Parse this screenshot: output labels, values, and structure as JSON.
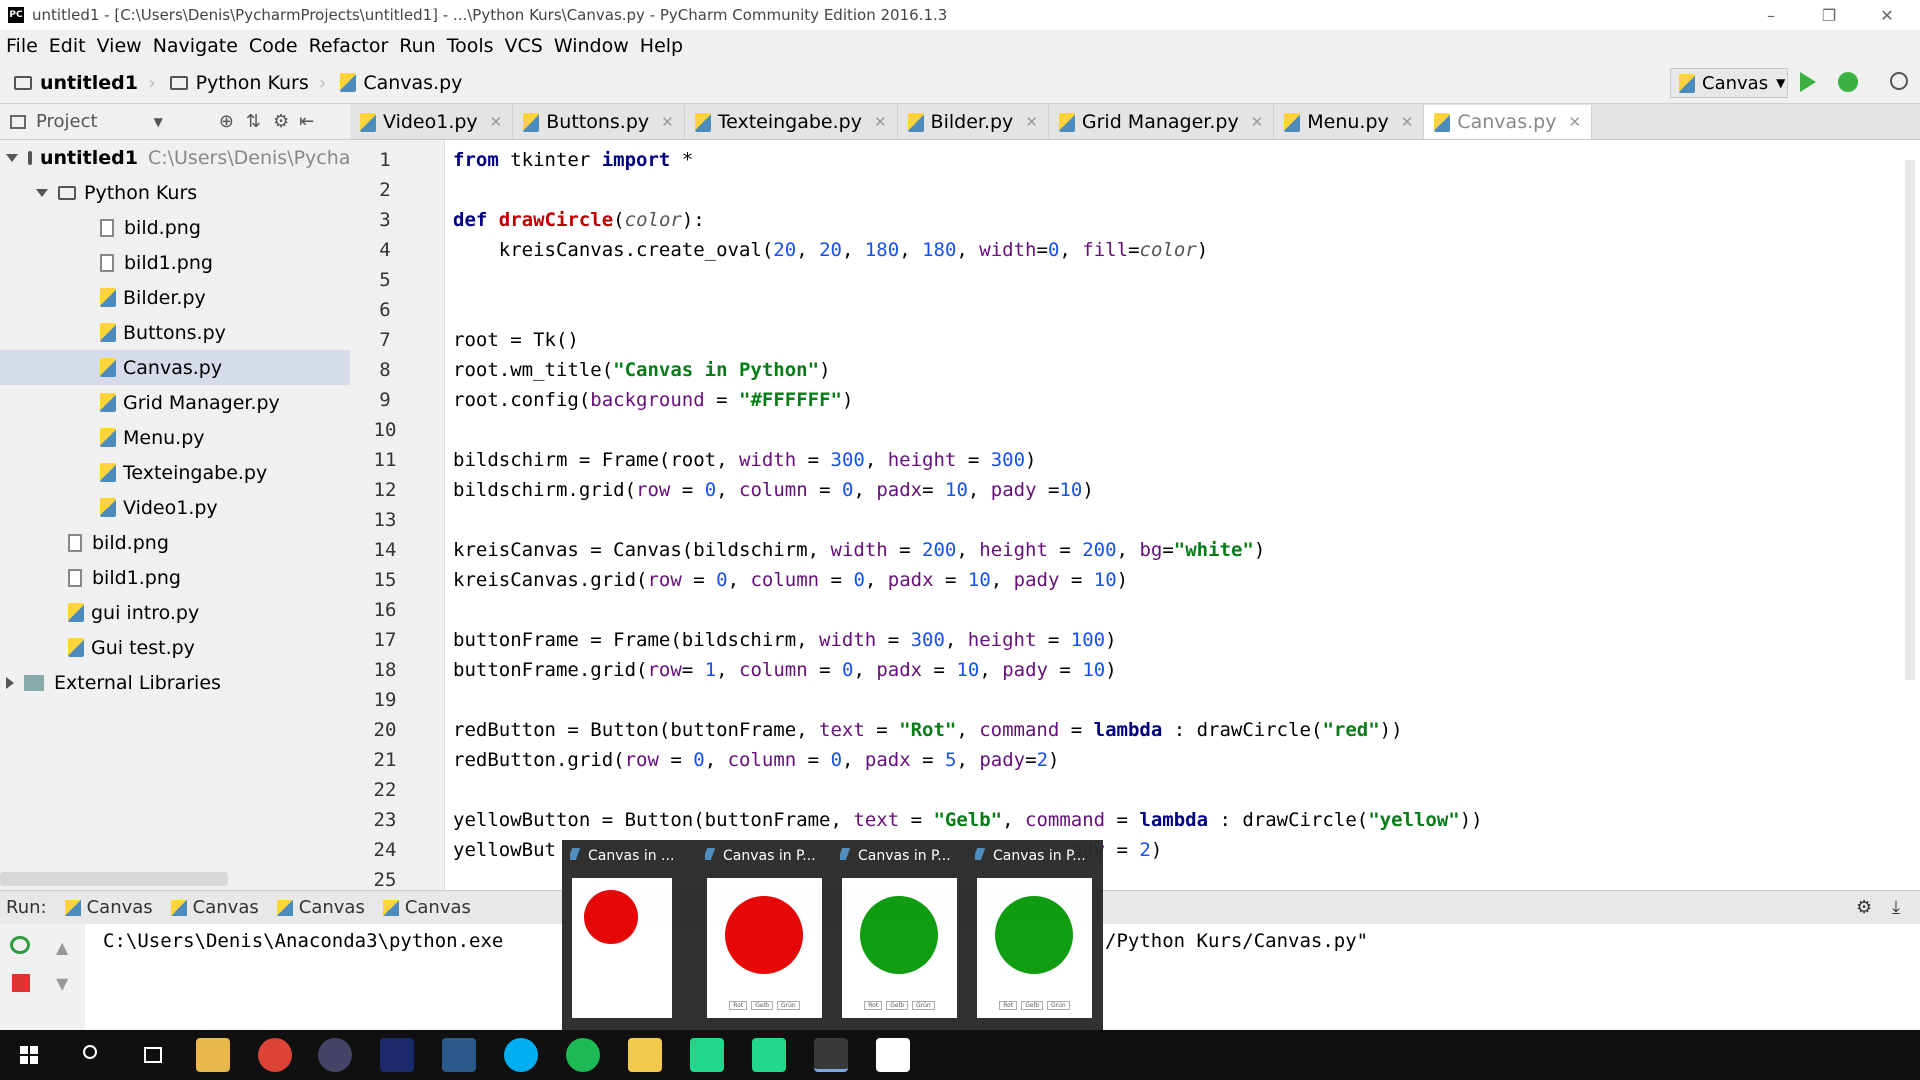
{
  "window": {
    "title": "untitled1 - [C:\\Users\\Denis\\PycharmProjects\\untitled1] - ...\\Python Kurs\\Canvas.py - PyCharm Community Edition 2016.1.3",
    "icon_label": "PC"
  },
  "menu": [
    "File",
    "Edit",
    "View",
    "Navigate",
    "Code",
    "Refactor",
    "Run",
    "Tools",
    "VCS",
    "Window",
    "Help"
  ],
  "breadcrumb": [
    "untitled1",
    "Python Kurs",
    "Canvas.py"
  ],
  "run_config": "Canvas",
  "project_label": "Project",
  "tabs": [
    {
      "label": "Video1.py",
      "active": false
    },
    {
      "label": "Buttons.py",
      "active": false
    },
    {
      "label": "Texteingabe.py",
      "active": false
    },
    {
      "label": "Bilder.py",
      "active": false
    },
    {
      "label": "Grid Manager.py",
      "active": false
    },
    {
      "label": "Menu.py",
      "active": false
    },
    {
      "label": "Canvas.py",
      "active": true
    }
  ],
  "tree": {
    "root_name": "untitled1",
    "root_path": "C:\\Users\\Denis\\Pycha",
    "folder": "Python Kurs",
    "folder_files": [
      "bild.png",
      "bild1.png",
      "Bilder.py",
      "Buttons.py",
      "Canvas.py",
      "Grid Manager.py",
      "Menu.py",
      "Texteingabe.py",
      "Video1.py"
    ],
    "root_files": [
      "bild.png",
      "bild1.png",
      "gui intro.py",
      "Gui test.py"
    ],
    "external": "External Libraries"
  },
  "line_numbers": [
    "1",
    "2",
    "3",
    "4",
    "5",
    "6",
    "7",
    "8",
    "9",
    "10",
    "11",
    "12",
    "13",
    "14",
    "15",
    "16",
    "17",
    "18",
    "19",
    "20",
    "21",
    "22",
    "23",
    "24",
    "25"
  ],
  "run": {
    "label": "Run:",
    "tabs": [
      "Canvas",
      "Canvas",
      "Canvas",
      "Canvas"
    ],
    "output_left": "C:\\Users\\Denis\\Anaconda3\\python.exe",
    "output_right": "/Python Kurs/Canvas.py\""
  },
  "thumbnails": [
    {
      "title": "Canvas in ...",
      "color": "#e60000"
    },
    {
      "title": "Canvas in P...",
      "color": "#e60000"
    },
    {
      "title": "Canvas in P...",
      "color": "#0a9a0a"
    },
    {
      "title": "Canvas in P...",
      "color": "#0a9a0a"
    }
  ],
  "thumb_buttons": [
    "Rot",
    "Gelb",
    "Grün"
  ]
}
